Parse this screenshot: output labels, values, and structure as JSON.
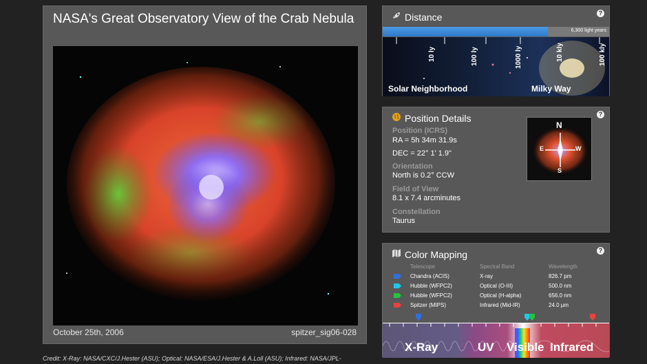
{
  "image_panel": {
    "title": "NASA's Great Observatory View of the Crab Nebula",
    "date": "October 25th, 2006",
    "image_id": "spitzer_sig06-028"
  },
  "credit": "Credit: X-Ray: NASA/CXC/J.Hester (ASU); Optical: NASA/ESA/J.Hester & A.Loll (ASU); Infrared: NASA/JPL-",
  "distance": {
    "title": "Distance",
    "bar_label": "6,300 light years",
    "bar_fraction": 0.73,
    "scale_labels": [
      "10 ly",
      "100 ly",
      "1000 ly",
      "10 kly",
      "100 kly"
    ],
    "left_caption": "Solar Neighborhood",
    "right_caption": "Milky Way"
  },
  "position": {
    "title": "Position Details",
    "position_label": "Position (ICRS)",
    "ra": "RA = 5h 34m 31.9s",
    "dec": "DEC = 22° 1' 1.9\"",
    "orientation_label": "Orientation",
    "orientation_value": "North is 0.2° CCW",
    "fov_label": "Field of View",
    "fov_value": "8.1 x 7.4 arcminutes",
    "constellation_label": "Constellation",
    "constellation_value": "Taurus",
    "compass": {
      "n": "N",
      "e": "E",
      "w": "W",
      "s": "S"
    }
  },
  "color_mapping": {
    "title": "Color Mapping",
    "headers": {
      "telescope": "Telescope",
      "band": "Spectral Band",
      "wavelength": "Wavelength"
    },
    "rows": [
      {
        "telescope": "Chandra (ACIS)",
        "band": "X-ray",
        "wavelength": "826.7 pm",
        "color": "#2f6fe0"
      },
      {
        "telescope": "Hubble (WFPC2)",
        "band": "Optical (O-III)",
        "wavelength": "500.0 nm",
        "color": "#22c6e8"
      },
      {
        "telescope": "Hubble (WFPC2)",
        "band": "Optical (H-alpha)",
        "wavelength": "656.0 nm",
        "color": "#25c43a"
      },
      {
        "telescope": "Spitzer (MIPS)",
        "band": "Infrared (Mid-IR)",
        "wavelength": "24.0 µm",
        "color": "#e8433f"
      }
    ],
    "bands": [
      "X-Ray",
      "UV",
      "Visible",
      "Infrared"
    ]
  },
  "help_symbol": "?",
  "icons": [
    "rocket-icon",
    "globe-icon",
    "map-icon",
    "help-icon"
  ]
}
